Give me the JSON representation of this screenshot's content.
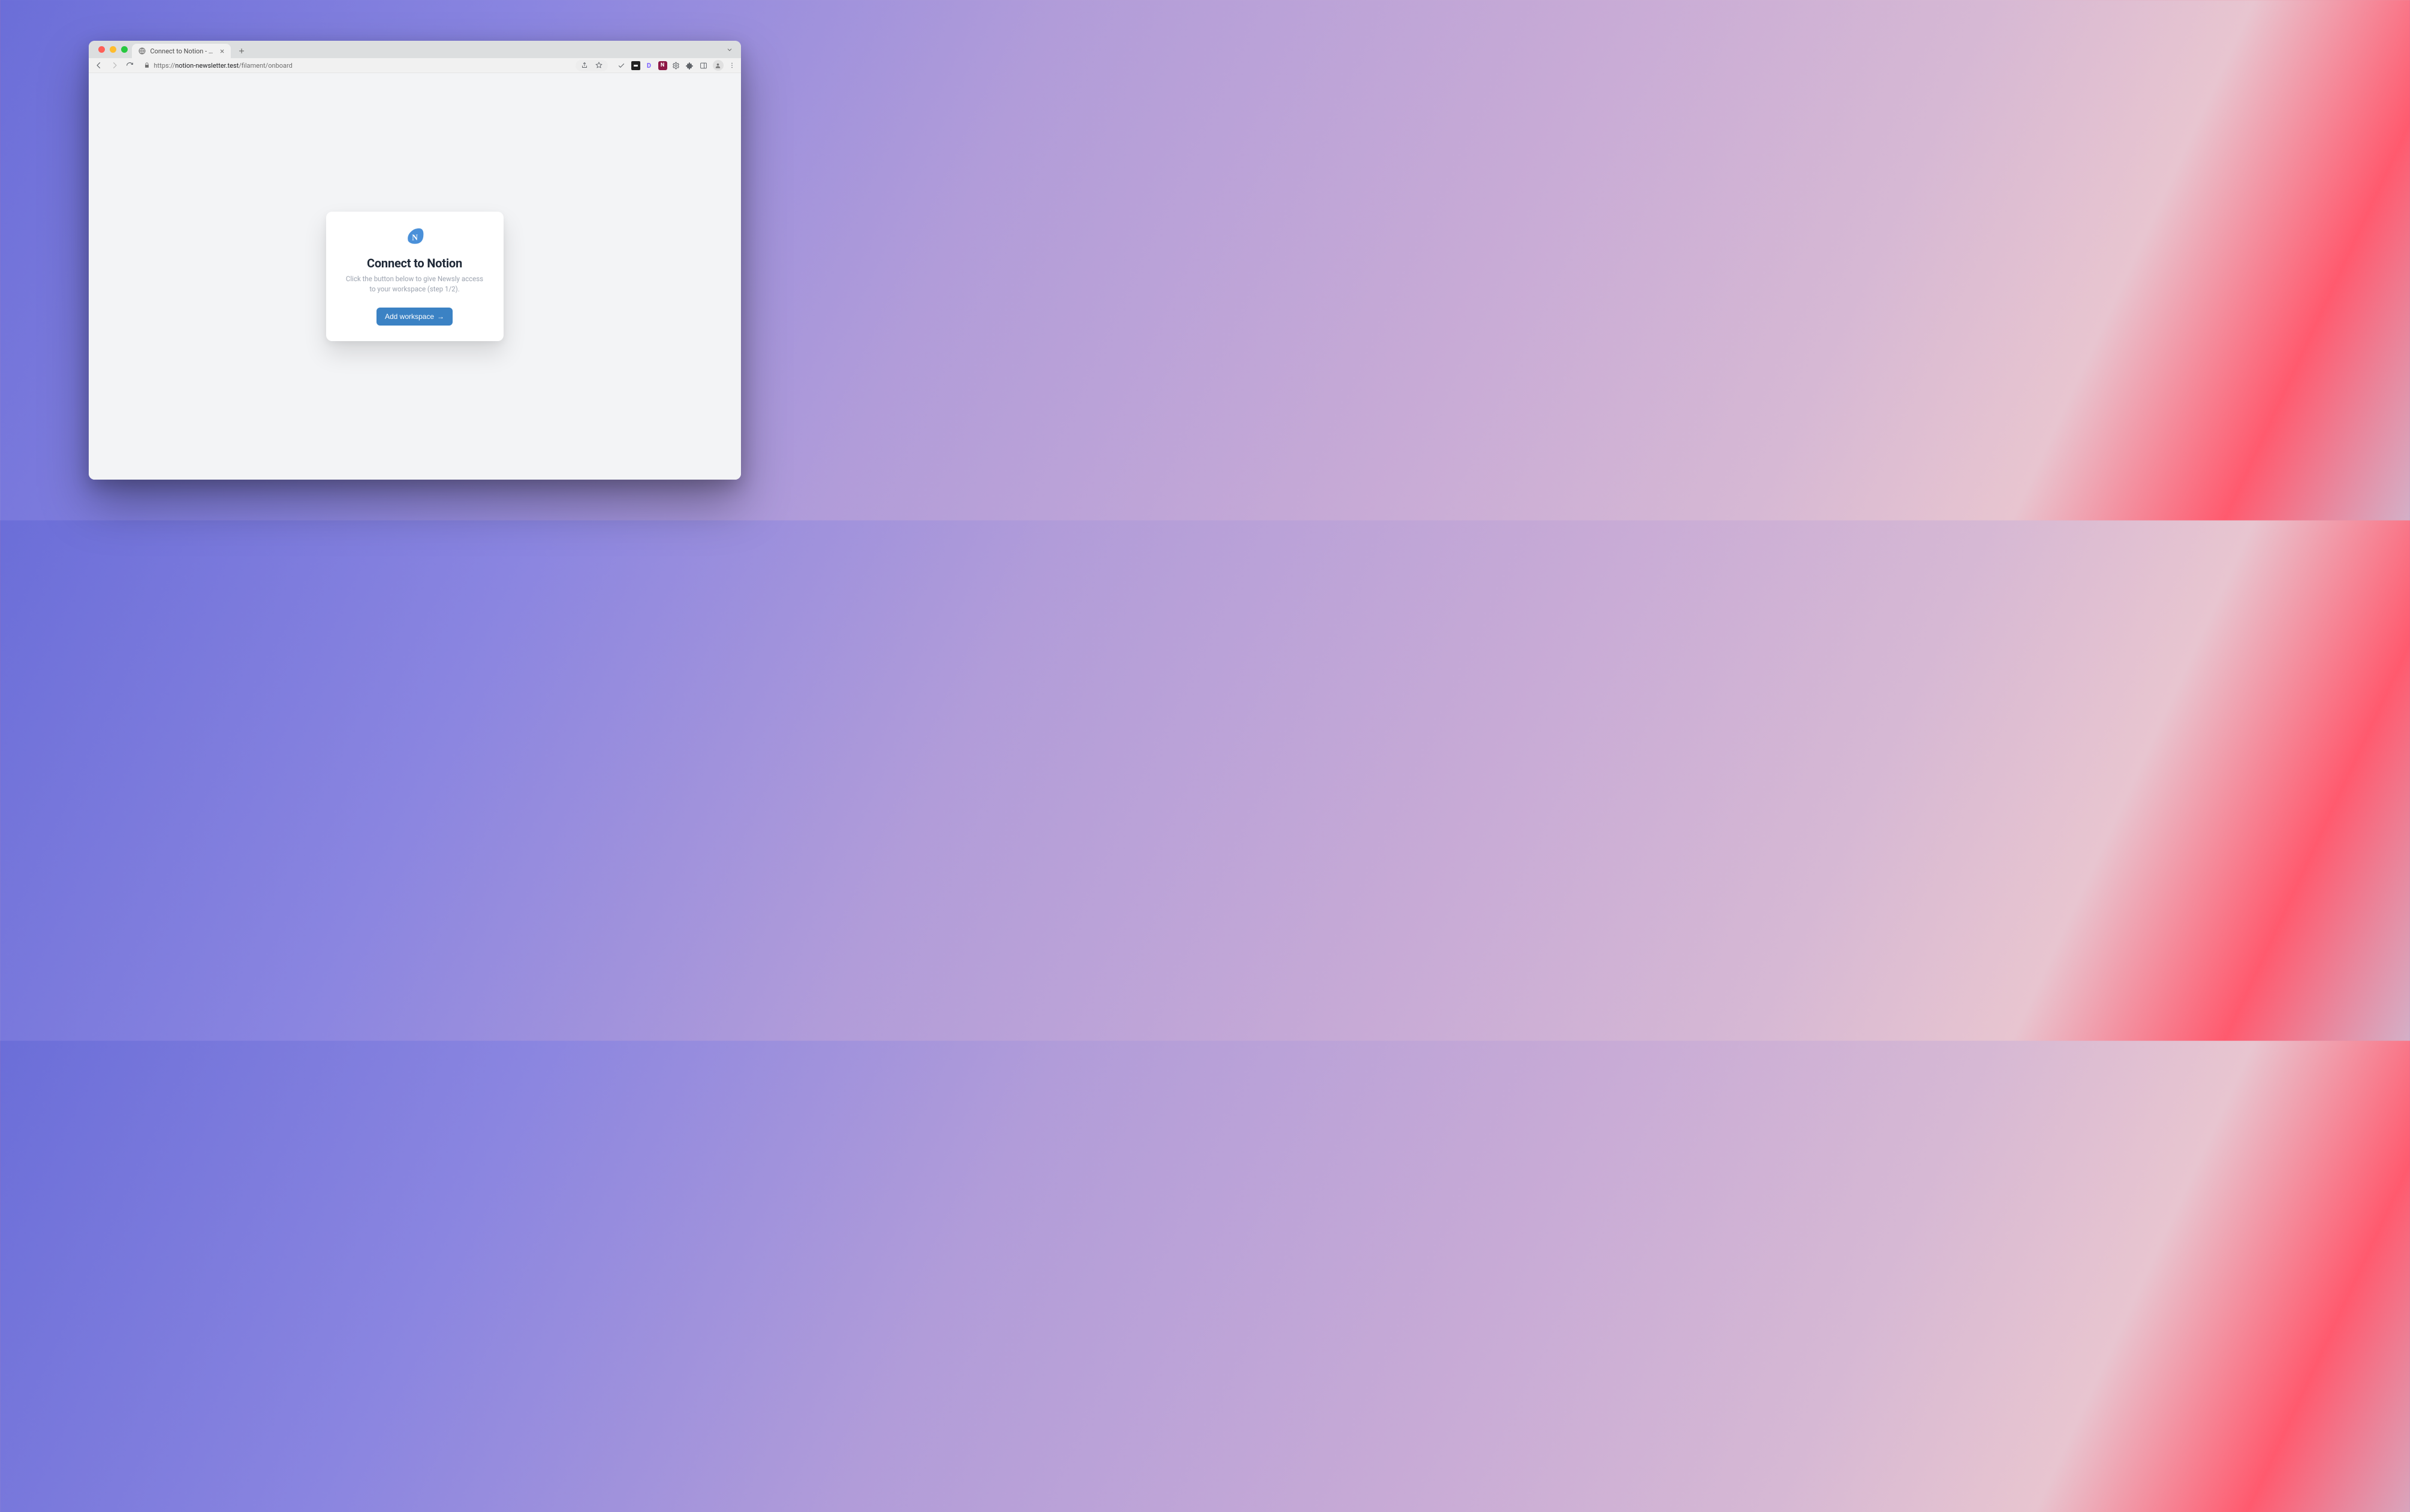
{
  "browser": {
    "tab": {
      "title": "Connect to Notion - Newsly"
    },
    "url": {
      "scheme": "https://",
      "host": "notion-newsletter.test",
      "path": "/filament/onboard"
    }
  },
  "card": {
    "logo_letter": "N",
    "heading": "Connect to Notion",
    "subtext": "Click the button below to give Newsly access to your workspace (step 1/2).",
    "cta_label": "Add workspace",
    "cta_arrow": "→"
  },
  "colors": {
    "accent": "#3b82c4",
    "logo": "#4a90d9"
  }
}
